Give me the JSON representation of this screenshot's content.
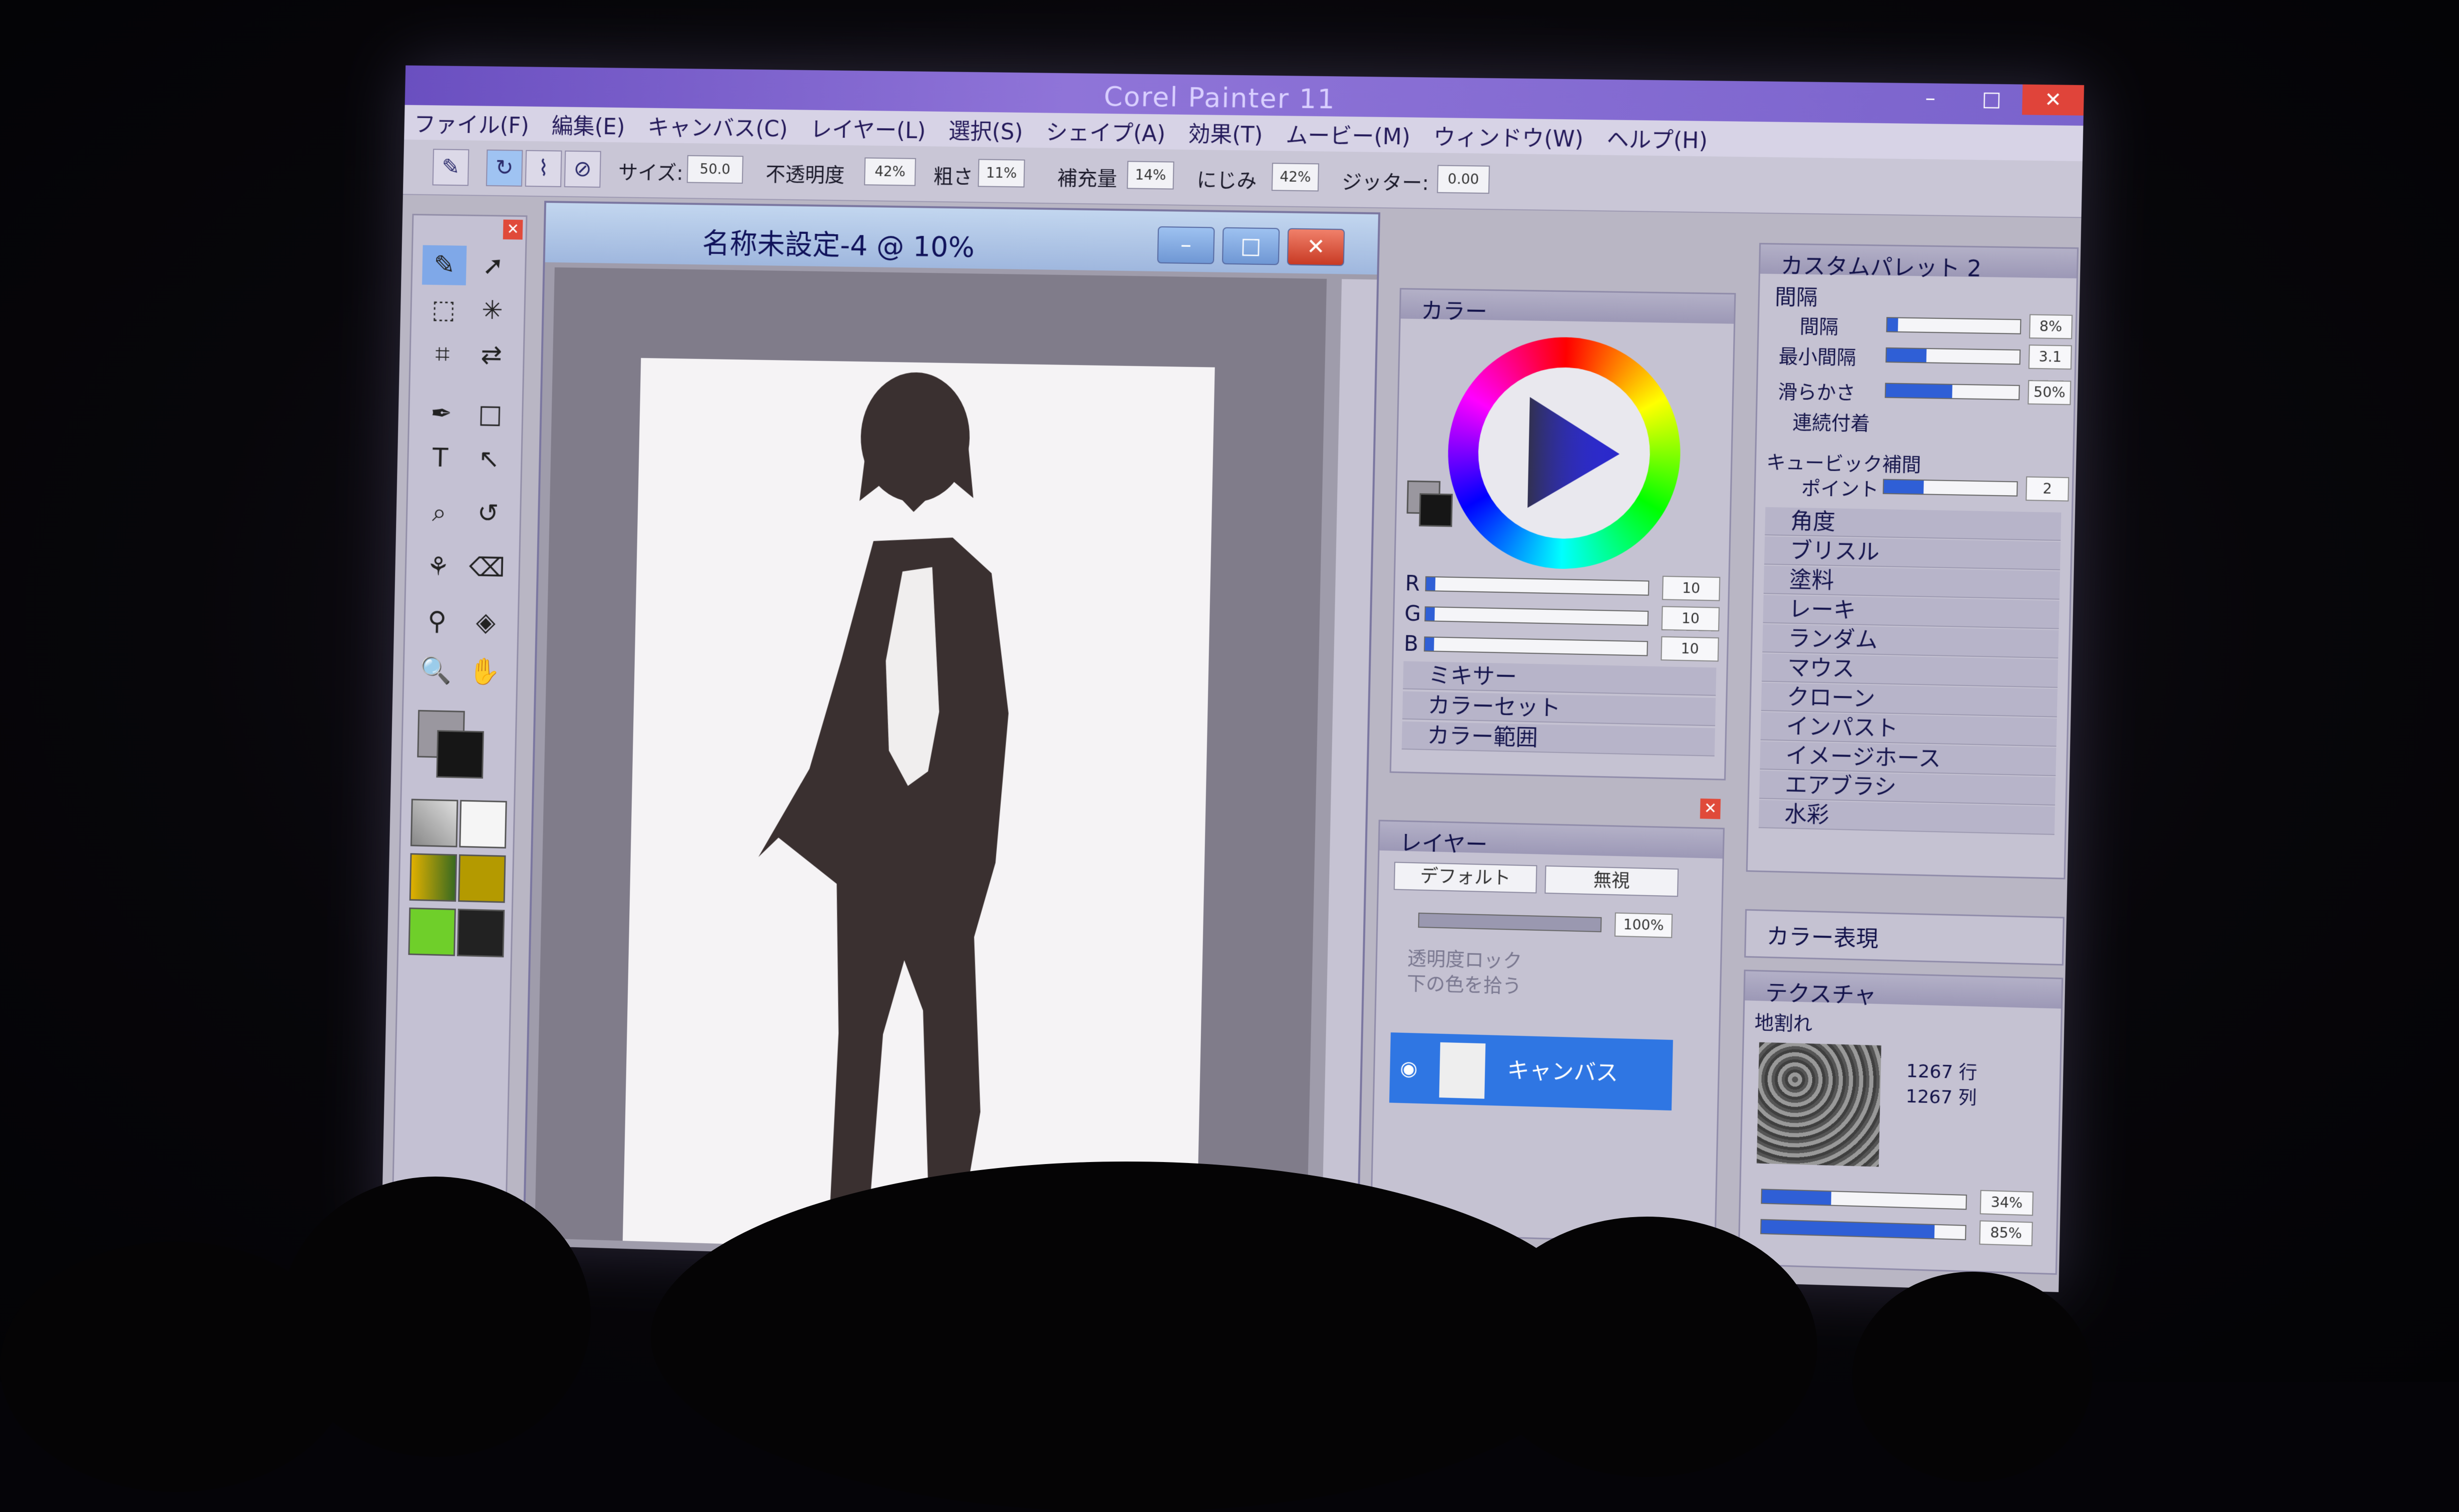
{
  "app": {
    "title": "Corel Painter 11"
  },
  "menu": [
    "ファイル(F)",
    "編集(E)",
    "キャンバス(C)",
    "レイヤー(L)",
    "選択(S)",
    "シェイプ(A)",
    "効果(T)",
    "ムービー(M)",
    "ウィンドウ(W)",
    "ヘルプ(H)"
  ],
  "property_bar": {
    "size_label": "サイズ:",
    "size_value": "50.0",
    "opacity_label": "不透明度",
    "opacity_value": "42%",
    "grain_label": "粗さ",
    "grain_value": "11%",
    "resat_label": "補充量",
    "resat_value": "14%",
    "bleed_label": "にじみ",
    "bleed_value": "42%",
    "jitter_label": "ジッター:",
    "jitter_value": "0.00"
  },
  "document": {
    "title": "名称未設定-4 @ 10%"
  },
  "color_panel": {
    "title": "カラー",
    "r_label": "R",
    "r_value": "10",
    "g_label": "G",
    "g_value": "10",
    "b_label": "B",
    "b_value": "10",
    "sections": [
      "ミキサー",
      "カラーセット",
      "カラー範囲"
    ]
  },
  "layer_panel": {
    "title": "レイヤー",
    "composite_method": "デフォルト",
    "composite_depth": "無視",
    "opacity": "100%",
    "preserve_transparency": "透明度ロック",
    "pick_up_color": "下の色を拾う",
    "layer_name": "キャンバス"
  },
  "custom_palette": {
    "title": "カスタムパレット 2",
    "section": "間隔",
    "spacing_label": "間隔",
    "spacing_value": "8%",
    "min_spacing_label": "最小間隔",
    "min_spacing_value": "3.1",
    "smoothing_label": "滑らかさ",
    "smoothing_value": "50%",
    "connect_dots": "連続付着",
    "cubic_label": "キュービック補間",
    "points_label": "ポイント",
    "points_value": "2",
    "sections": [
      "角度",
      "ブリスル",
      "塗料",
      "レーキ",
      "ランダム",
      "マウス",
      "クローン",
      "インパスト",
      "イメージホース",
      "エアブラシ",
      "水彩"
    ]
  },
  "color_express": {
    "title": "カラー表現"
  },
  "texture_panel": {
    "title": "テクスチャ",
    "paper_name": "地割れ",
    "rows": "1267 行",
    "cols": "1267 列",
    "scale_value": "34%",
    "contrast_value": "85%"
  },
  "colors": {
    "accent": "#2f76e3",
    "titlebar": "#7a63cc",
    "close": "#e0443a"
  }
}
